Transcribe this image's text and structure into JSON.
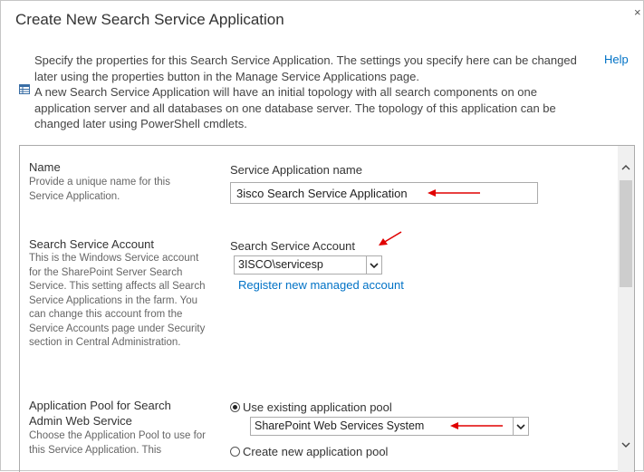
{
  "dialog": {
    "title": "Create New Search Service Application",
    "close_glyph": "×",
    "help_label": "Help",
    "intro_paragraph_1": "Specify the properties for this Search Service Application. The settings you specify here can be changed later using the properties button in the Manage Service Applications page.",
    "intro_paragraph_2": "A new Search Service Application will have an initial topology with all search components on one application server and all databases on one database server. The topology of this application can be changed later using PowerShell cmdlets.",
    "intro_icon": "info-table-icon"
  },
  "sections": {
    "name": {
      "title": "Name",
      "description": "Provide a unique name for this Service Application.",
      "field_label": "Service Application name",
      "field_value": "3isco Search Service Application"
    },
    "account": {
      "title": "Search Service Account",
      "description": "This is the Windows Service account for the SharePoint Server Search Service. This setting affects all Search Service Applications in the farm. You can change this account from the Service Accounts page under Security section in Central Administration.",
      "field_label": "Search Service Account",
      "selected_value": "3ISCO\\servicesp",
      "register_link": "Register new managed account"
    },
    "app_pool": {
      "title": "Application Pool for Search Admin Web Service",
      "description": "Choose the Application Pool to use for this Service Application.  This",
      "use_existing_label": "Use existing application pool",
      "selected_pool": "SharePoint Web Services System",
      "create_new_label": "Create new application pool"
    }
  },
  "colors": {
    "link": "#0072c6",
    "annotation_arrow": "#e00000",
    "border": "#ababab"
  }
}
